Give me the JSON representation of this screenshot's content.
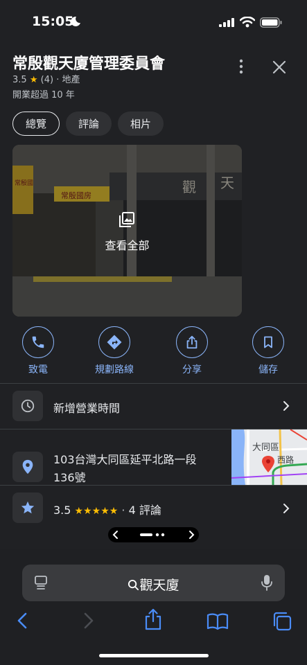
{
  "status": {
    "time": "15:05"
  },
  "place": {
    "title": "常殷觀天廈管理委員會",
    "rating": "3.5",
    "rating_star": "★",
    "review_count": "(4)",
    "category": "地產",
    "open_years": "開業超過 10 年"
  },
  "tabs": [
    {
      "label": "總覽",
      "active": true
    },
    {
      "label": "評論",
      "active": false
    },
    {
      "label": "相片",
      "active": false
    }
  ],
  "photo": {
    "view_all_label": "查看全部",
    "signage": "觀",
    "signage2": "天",
    "shop_sign": "常殷國房",
    "shop_sign2": "常殷國"
  },
  "actions": [
    {
      "label": "致電",
      "icon": "phone-icon"
    },
    {
      "label": "規劃路線",
      "icon": "directions-icon"
    },
    {
      "label": "分享",
      "icon": "share-icon"
    },
    {
      "label": "儲存",
      "icon": "bookmark-icon"
    }
  ],
  "rows": {
    "hours": {
      "label": "新增營業時間",
      "icon": "clock-icon"
    },
    "address": {
      "line1": "103台灣大同區延平北路一段",
      "line2": "136號",
      "icon": "location-pin-icon"
    },
    "reviews": {
      "rating": "3.5",
      "stars": "★★★★★",
      "separator": "·",
      "count_label": "4 評論",
      "icon": "star-icon",
      "star_fraction": 0.7
    }
  },
  "map_labels": {
    "district": "大同區",
    "road": "西路"
  },
  "browser": {
    "search_text": "觀天廈"
  },
  "colors": {
    "accent": "#8ab4f8",
    "star": "#fbbc04",
    "background": "#202124",
    "pin": "#ea4335"
  }
}
